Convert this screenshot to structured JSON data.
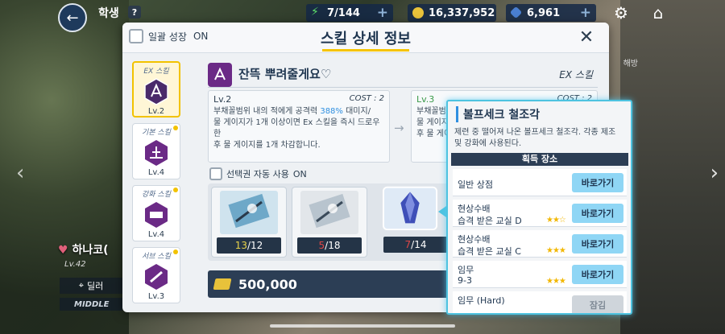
{
  "topbar": {
    "title": "학생",
    "help_label": "?",
    "ap": "7/144",
    "credits": "16,337,952",
    "pyroxene": "6,961"
  },
  "background": {
    "character_name": "하나코(",
    "character_level": "Lv.42",
    "role_label": "딜러",
    "position_label": "MIDDLE",
    "right_tag": "해방"
  },
  "dialog": {
    "title": "스킬 상세 정보",
    "bulk_growth_label": "일괄 성장",
    "bulk_growth_state": "ON",
    "skill_tabs": [
      {
        "type": "EX 스킬",
        "level": "Lv.2",
        "selected": true,
        "icon": "ex-skill-icon"
      },
      {
        "type": "기본 스킬",
        "level": "Lv.4",
        "selected": false,
        "icon": "basic-skill-icon"
      },
      {
        "type": "강화 스킬",
        "level": "Lv.4",
        "selected": false,
        "icon": "enhanced-skill-icon"
      },
      {
        "type": "서브 스킬",
        "level": "Lv.3",
        "selected": false,
        "icon": "sub-skill-icon"
      }
    ],
    "skill": {
      "name": "잔뜩 뿌려줄게요♡",
      "kind": "EX 스킬",
      "current": {
        "level": "Lv.2",
        "cost": "COST : 2",
        "desc_a": "부채꼴범위 내의 적에게 공격력 ",
        "desc_highlight": "388%",
        "desc_b": " 대미지/",
        "desc_c": "물 게이지가 1개 이상이면 Ex 스킬을 즉시 드로우한",
        "desc_d": "후 물 게이지를 1개 차감합니다."
      },
      "next": {
        "level": "Lv.3",
        "cost": "COST : 2",
        "desc_a": "부채꼴범",
        "desc_c": "물 게이지",
        "desc_d": "후 물 게이"
      }
    },
    "auto_use_label": "선택권 자동 사용",
    "auto_use_state": "ON",
    "materials": [
      {
        "have": "13",
        "need": "/12",
        "enough": true
      },
      {
        "have": "5",
        "need": "/18",
        "enough": false
      },
      {
        "have": "7",
        "need": "/14",
        "enough": false
      }
    ],
    "credit_cost": "500,000"
  },
  "tooltip": {
    "title": "볼프세크 철조각",
    "description": "제련 중 떨어져 나온 볼프세크 철조각. 각종 제조 및 강화에 사용된다.",
    "section_label": "획득 장소",
    "sources": [
      {
        "name": "일반 상점",
        "sub": "",
        "stars": "",
        "button": "바로가기",
        "locked": false
      },
      {
        "name": "현상수배",
        "sub": "습격 받은 교실 D",
        "stars": "★★☆",
        "button": "바로가기",
        "locked": false
      },
      {
        "name": "현상수배",
        "sub": "습격 받은 교실 C",
        "stars": "★★★",
        "button": "바로가기",
        "locked": false
      },
      {
        "name": "임무",
        "sub": "9-3",
        "stars": "★★★",
        "button": "바로가기",
        "locked": false
      },
      {
        "name": "임무 (Hard)",
        "sub": "",
        "stars": "",
        "button": "잠김",
        "locked": true
      }
    ]
  },
  "colors": {
    "accent_yellow": "#f2c200",
    "highlight_blue": "#2f8fe0",
    "tooltip_border": "#4ec3e0",
    "skill_purple": "#6b2a86"
  }
}
